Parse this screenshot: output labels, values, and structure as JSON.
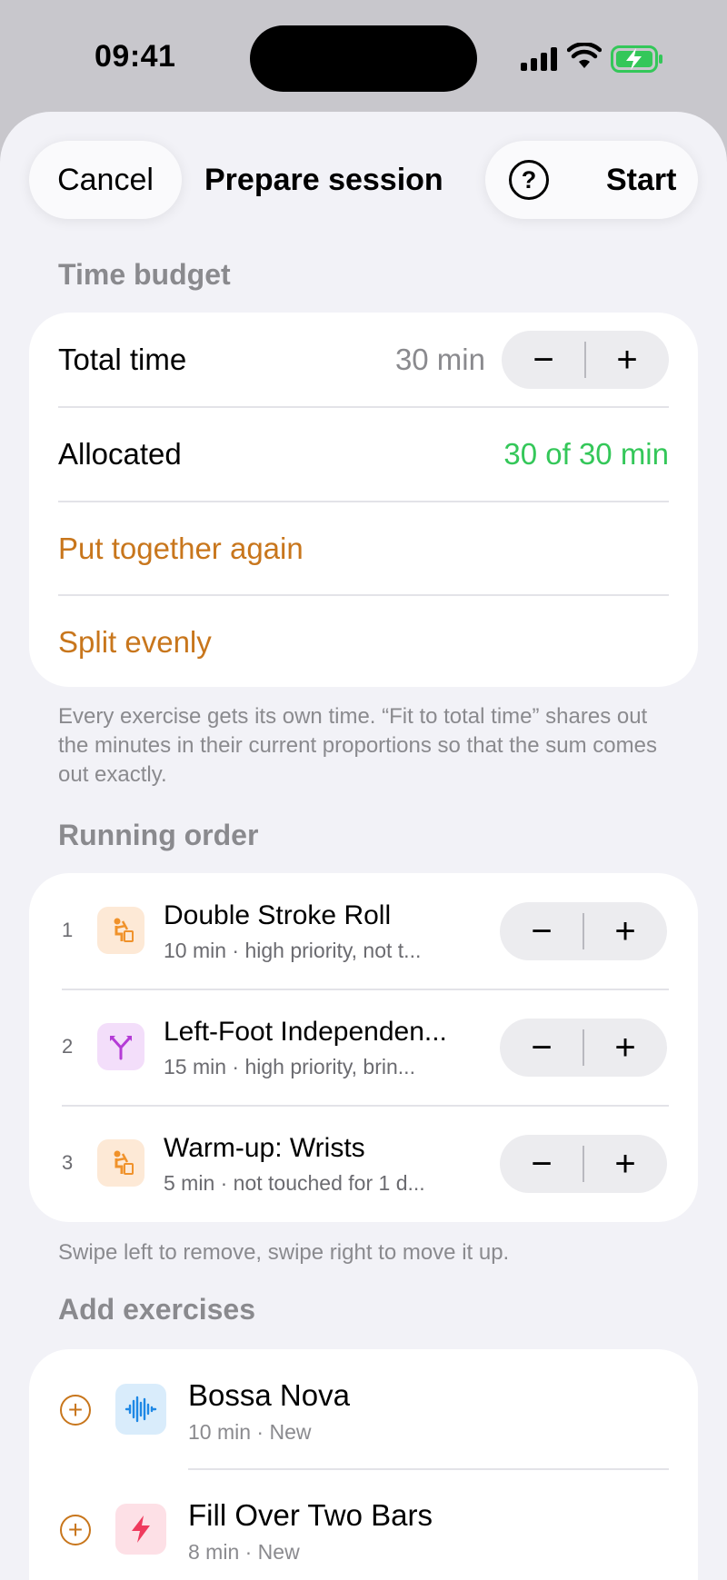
{
  "status_bar": {
    "time": "09:41"
  },
  "nav": {
    "cancel_label": "Cancel",
    "title": "Prepare session",
    "help_symbol": "?",
    "start_label": "Start"
  },
  "time_budget": {
    "header": "Time budget",
    "total_label": "Total time",
    "total_value": "30 min",
    "allocated_label": "Allocated",
    "allocated_value": "30 of 30 min",
    "put_together_label": "Put together again",
    "split_label": "Split evenly",
    "footnote": "Every exercise gets its own time. “Fit to total time” shares out the minutes in their current proportions so that the sum comes out exactly."
  },
  "running_order": {
    "header": "Running order",
    "items": [
      {
        "num": "1",
        "title": "Double Stroke Roll",
        "subtitle": "10 min · high priority, not t...",
        "icon": "drummer-icon",
        "icon_color": "#f0922b",
        "icon_bg": "#fde9d6"
      },
      {
        "num": "2",
        "title": "Left-Foot Independen...",
        "subtitle": "15 min · high priority, brin...",
        "icon": "split-arrows-icon",
        "icon_color": "#b43bd6",
        "icon_bg": "#f3defa"
      },
      {
        "num": "3",
        "title": "Warm-up: Wrists",
        "subtitle": "5 min · not touched for 1 d...",
        "icon": "drummer-icon",
        "icon_color": "#f0922b",
        "icon_bg": "#fde9d6"
      }
    ],
    "footnote": "Swipe left to remove, swipe right to move it up."
  },
  "add_exercises": {
    "header": "Add exercises",
    "items": [
      {
        "title": "Bossa Nova",
        "subtitle": "10 min · New",
        "icon": "waveform-icon",
        "icon_color": "#1e88e5",
        "icon_bg": "#d9ecfb"
      },
      {
        "title": "Fill Over Two Bars",
        "subtitle": "8 min · New",
        "icon": "bolt-icon",
        "icon_color": "#ef3a5d",
        "icon_bg": "#fde0e6"
      }
    ]
  },
  "stepper": {
    "minus": "−",
    "plus": "+"
  },
  "colors": {
    "accent": "#c8761c",
    "positive": "#34c759",
    "background": "#f2f2f7"
  }
}
